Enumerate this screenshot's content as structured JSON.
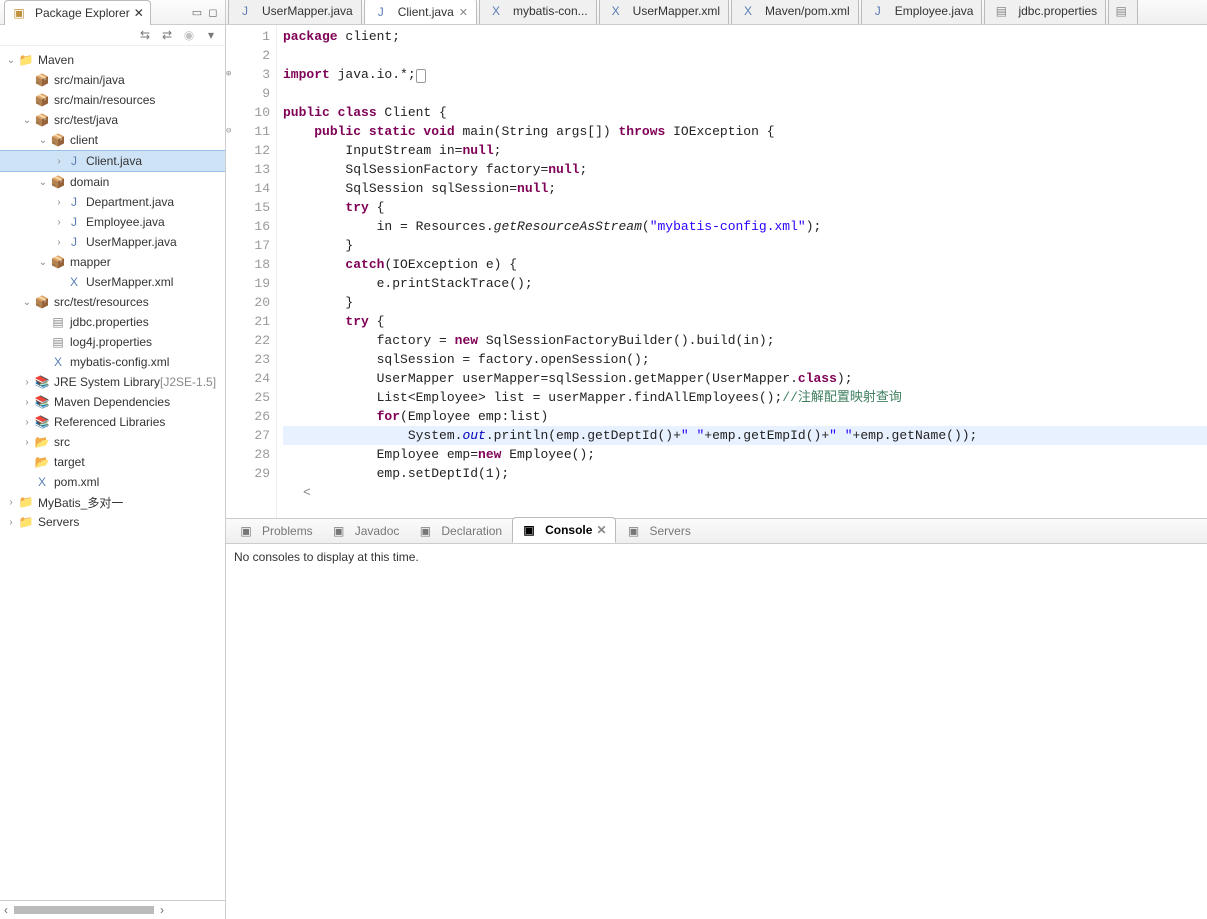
{
  "explorer": {
    "title": "Package Explorer",
    "nodes": [
      {
        "depth": 0,
        "tw": "v",
        "icon": "proj",
        "label": "Maven"
      },
      {
        "depth": 1,
        "tw": "",
        "icon": "pkg",
        "label": "src/main/java"
      },
      {
        "depth": 1,
        "tw": "",
        "icon": "pkg",
        "label": "src/main/resources"
      },
      {
        "depth": 1,
        "tw": "v",
        "icon": "pkg",
        "label": "src/test/java"
      },
      {
        "depth": 2,
        "tw": "v",
        "icon": "pkg",
        "label": "client"
      },
      {
        "depth": 3,
        "tw": ">",
        "icon": "java",
        "label": "Client.java",
        "selected": true
      },
      {
        "depth": 2,
        "tw": "v",
        "icon": "pkg",
        "label": "domain"
      },
      {
        "depth": 3,
        "tw": ">",
        "icon": "java",
        "label": "Department.java"
      },
      {
        "depth": 3,
        "tw": ">",
        "icon": "java",
        "label": "Employee.java"
      },
      {
        "depth": 3,
        "tw": ">",
        "icon": "java",
        "label": "UserMapper.java"
      },
      {
        "depth": 2,
        "tw": "v",
        "icon": "pkg",
        "label": "mapper"
      },
      {
        "depth": 3,
        "tw": "",
        "icon": "xml",
        "label": "UserMapper.xml"
      },
      {
        "depth": 1,
        "tw": "v",
        "icon": "pkg",
        "label": "src/test/resources"
      },
      {
        "depth": 2,
        "tw": "",
        "icon": "file",
        "label": "jdbc.properties"
      },
      {
        "depth": 2,
        "tw": "",
        "icon": "file",
        "label": "log4j.properties"
      },
      {
        "depth": 2,
        "tw": "",
        "icon": "xml",
        "label": "mybatis-config.xml"
      },
      {
        "depth": 1,
        "tw": ">",
        "icon": "lib",
        "label": "JRE System Library",
        "suffix": "[J2SE-1.5]"
      },
      {
        "depth": 1,
        "tw": ">",
        "icon": "lib",
        "label": "Maven Dependencies"
      },
      {
        "depth": 1,
        "tw": ">",
        "icon": "lib",
        "label": "Referenced Libraries"
      },
      {
        "depth": 1,
        "tw": ">",
        "icon": "fold",
        "label": "src"
      },
      {
        "depth": 1,
        "tw": "",
        "icon": "fold",
        "label": "target"
      },
      {
        "depth": 1,
        "tw": "",
        "icon": "xml",
        "label": "pom.xml"
      },
      {
        "depth": 0,
        "tw": ">",
        "icon": "proj",
        "label": "MyBatis_多对一"
      },
      {
        "depth": 0,
        "tw": ">",
        "icon": "proj",
        "label": "Servers"
      }
    ]
  },
  "editorTabs": [
    {
      "icon": "java",
      "label": "UserMapper.java",
      "active": false,
      "close": false
    },
    {
      "icon": "java",
      "label": "Client.java",
      "active": true,
      "close": true
    },
    {
      "icon": "xml",
      "label": "mybatis-con...",
      "active": false,
      "close": false
    },
    {
      "icon": "xml",
      "label": "UserMapper.xml",
      "active": false,
      "close": false
    },
    {
      "icon": "xml",
      "label": "Maven/pom.xml",
      "active": false,
      "close": false
    },
    {
      "icon": "java",
      "label": "Employee.java",
      "active": false,
      "close": false
    },
    {
      "icon": "file",
      "label": "jdbc.properties",
      "active": false,
      "close": false
    }
  ],
  "code": {
    "lines": [
      {
        "n": "1",
        "html": "<span class='kw'>package</span> client;"
      },
      {
        "n": "2",
        "html": ""
      },
      {
        "n": "3",
        "ann": "⊕",
        "html": "<span class='kw'>import</span> java.io.*;<span class='box'>&nbsp;</span>"
      },
      {
        "n": "9",
        "html": ""
      },
      {
        "n": "10",
        "html": "<span class='kw'>public class</span> Client {"
      },
      {
        "n": "11",
        "ann": "⊖",
        "html": "    <span class='kw'>public static void</span> main(String args[]) <span class='kw'>throws</span> IOException {"
      },
      {
        "n": "12",
        "html": "        InputStream in=<span class='kw'>null</span>;"
      },
      {
        "n": "13",
        "html": "        SqlSessionFactory factory=<span class='kw'>null</span>;"
      },
      {
        "n": "14",
        "html": "        SqlSession sqlSession=<span class='kw'>null</span>;"
      },
      {
        "n": "15",
        "html": "        <span class='kw'>try</span> {"
      },
      {
        "n": "16",
        "html": "            in = Resources.<span class='mtd'>getResourceAsStream</span>(<span class='str'>\"mybatis-config.xml\"</span>);"
      },
      {
        "n": "17",
        "html": "        }"
      },
      {
        "n": "18",
        "html": "        <span class='kw'>catch</span>(IOException e) {"
      },
      {
        "n": "19",
        "html": "            e.printStackTrace();"
      },
      {
        "n": "20",
        "html": "        }"
      },
      {
        "n": "21",
        "html": "        <span class='kw'>try</span> {"
      },
      {
        "n": "22",
        "html": "            factory = <span class='kw'>new</span> SqlSessionFactoryBuilder().build(in);"
      },
      {
        "n": "23",
        "html": "            sqlSession = factory.openSession();"
      },
      {
        "n": "24",
        "html": "            UserMapper userMapper=sqlSession.getMapper(UserMapper.<span class='kw'>class</span>);"
      },
      {
        "n": "25",
        "html": "            List&lt;Employee&gt; list = userMapper.findAllEmployees();<span class='cm'>//注解配置映射查询</span>"
      },
      {
        "n": "26",
        "html": "            <span class='kw'>for</span>(Employee emp:list)"
      },
      {
        "n": "27",
        "hl": true,
        "html": "                System.<span class='fld'>out</span>.println(emp.getDeptId()+<span class='str'>\" \"</span>+emp.getEmpId()+<span class='str'>\" \"</span>+emp.getName());"
      },
      {
        "n": "28",
        "html": "            Employee emp=<span class='kw'>new</span> Employee();"
      },
      {
        "n": "29",
        "html": "            emp.setDeptId(1);"
      }
    ]
  },
  "bottomTabs": [
    {
      "label": "Problems",
      "active": false
    },
    {
      "label": "Javadoc",
      "active": false
    },
    {
      "label": "Declaration",
      "active": false
    },
    {
      "label": "Console",
      "active": true,
      "close": true
    },
    {
      "label": "Servers",
      "active": false
    }
  ],
  "console": {
    "message": "No consoles to display at this time."
  }
}
